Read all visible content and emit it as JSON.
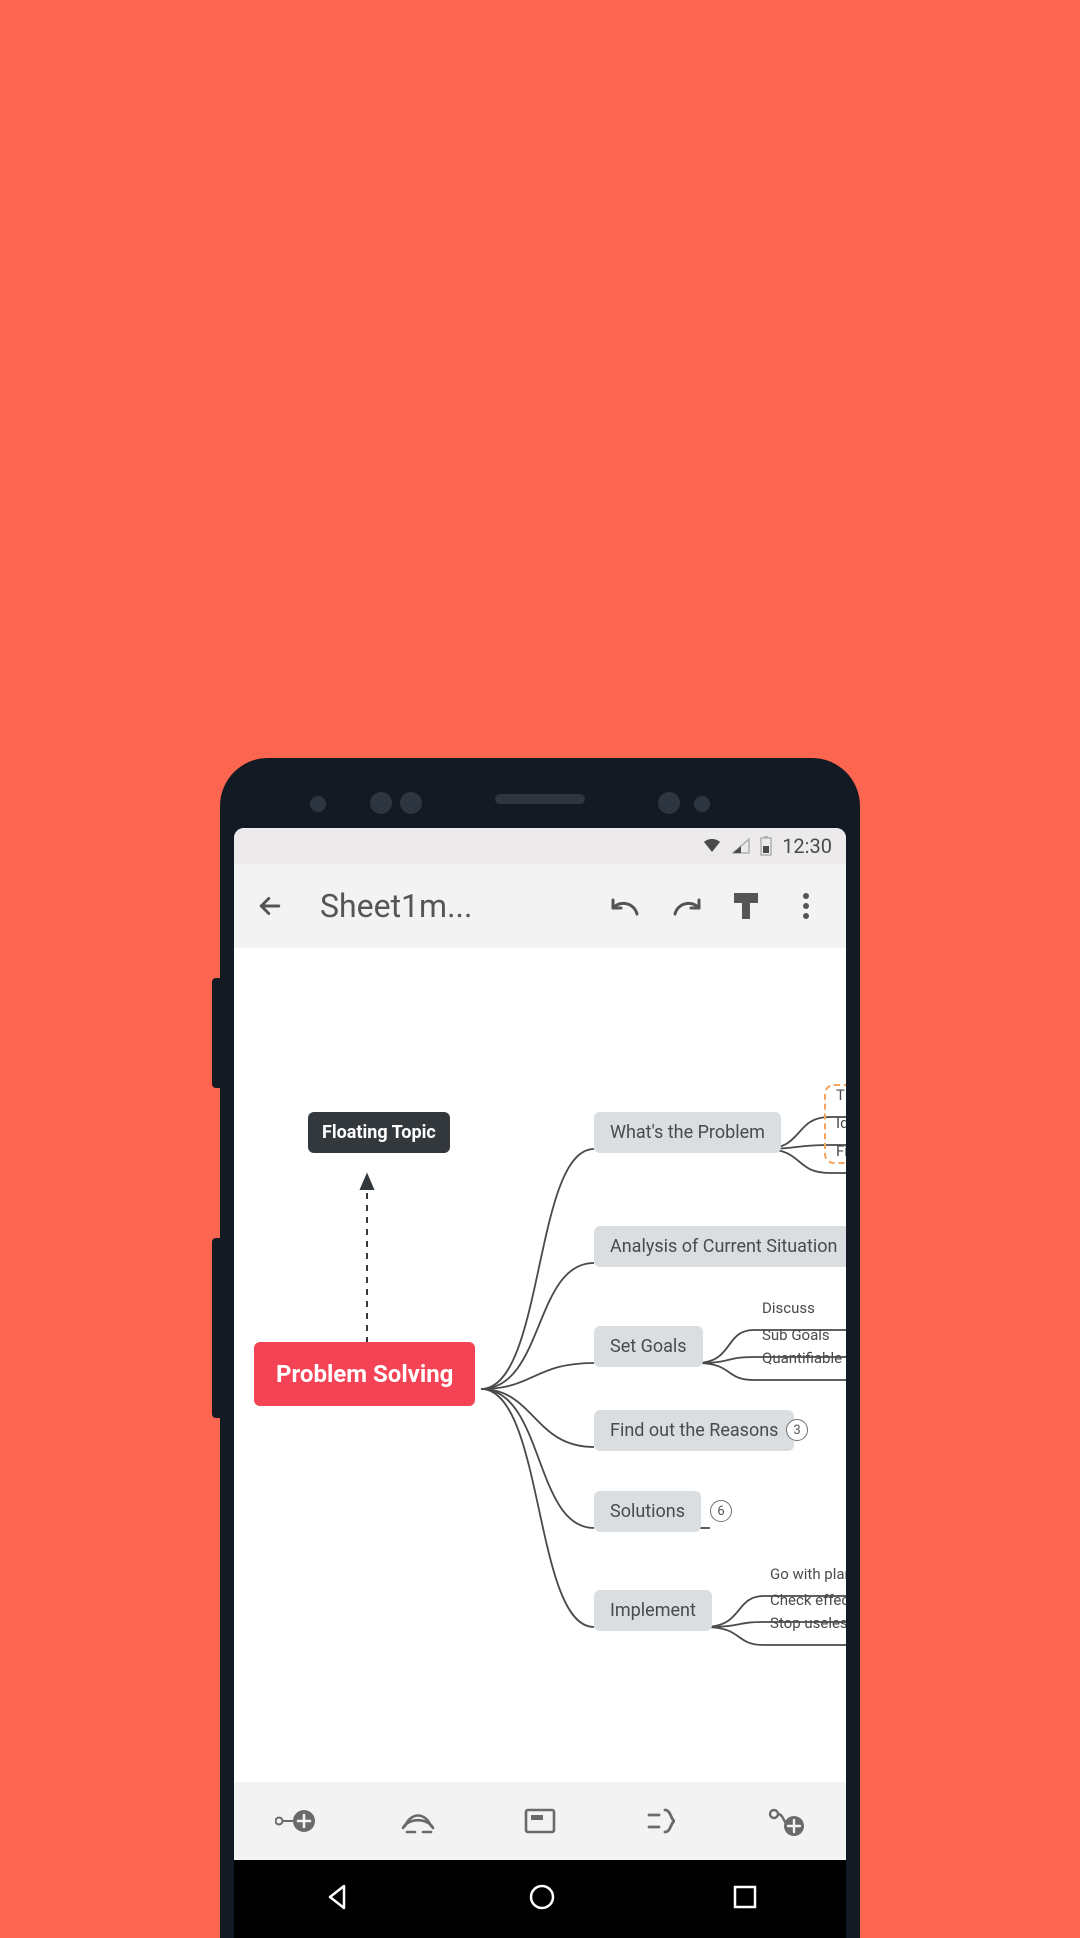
{
  "statusbar": {
    "time": "12:30"
  },
  "appbar": {
    "title": "Sheet1m..."
  },
  "mindmap": {
    "root": "Problem Solving",
    "floating": "Floating Topic",
    "branches": [
      {
        "label": "What's the Problem",
        "leaves": [
          "Th",
          "Ide",
          "Fin"
        ]
      },
      {
        "label": "Analysis of Current Situation"
      },
      {
        "label": "Set Goals",
        "leaves": [
          "Discuss",
          "Sub Goals",
          "Quantifiable targe"
        ]
      },
      {
        "label": "Find out the Reasons",
        "badge": "3"
      },
      {
        "label": "Solutions",
        "badge": "6"
      },
      {
        "label": "Implement",
        "leaves": [
          "Go with plans",
          "Check effect of",
          "Stop useless so"
        ]
      }
    ]
  }
}
